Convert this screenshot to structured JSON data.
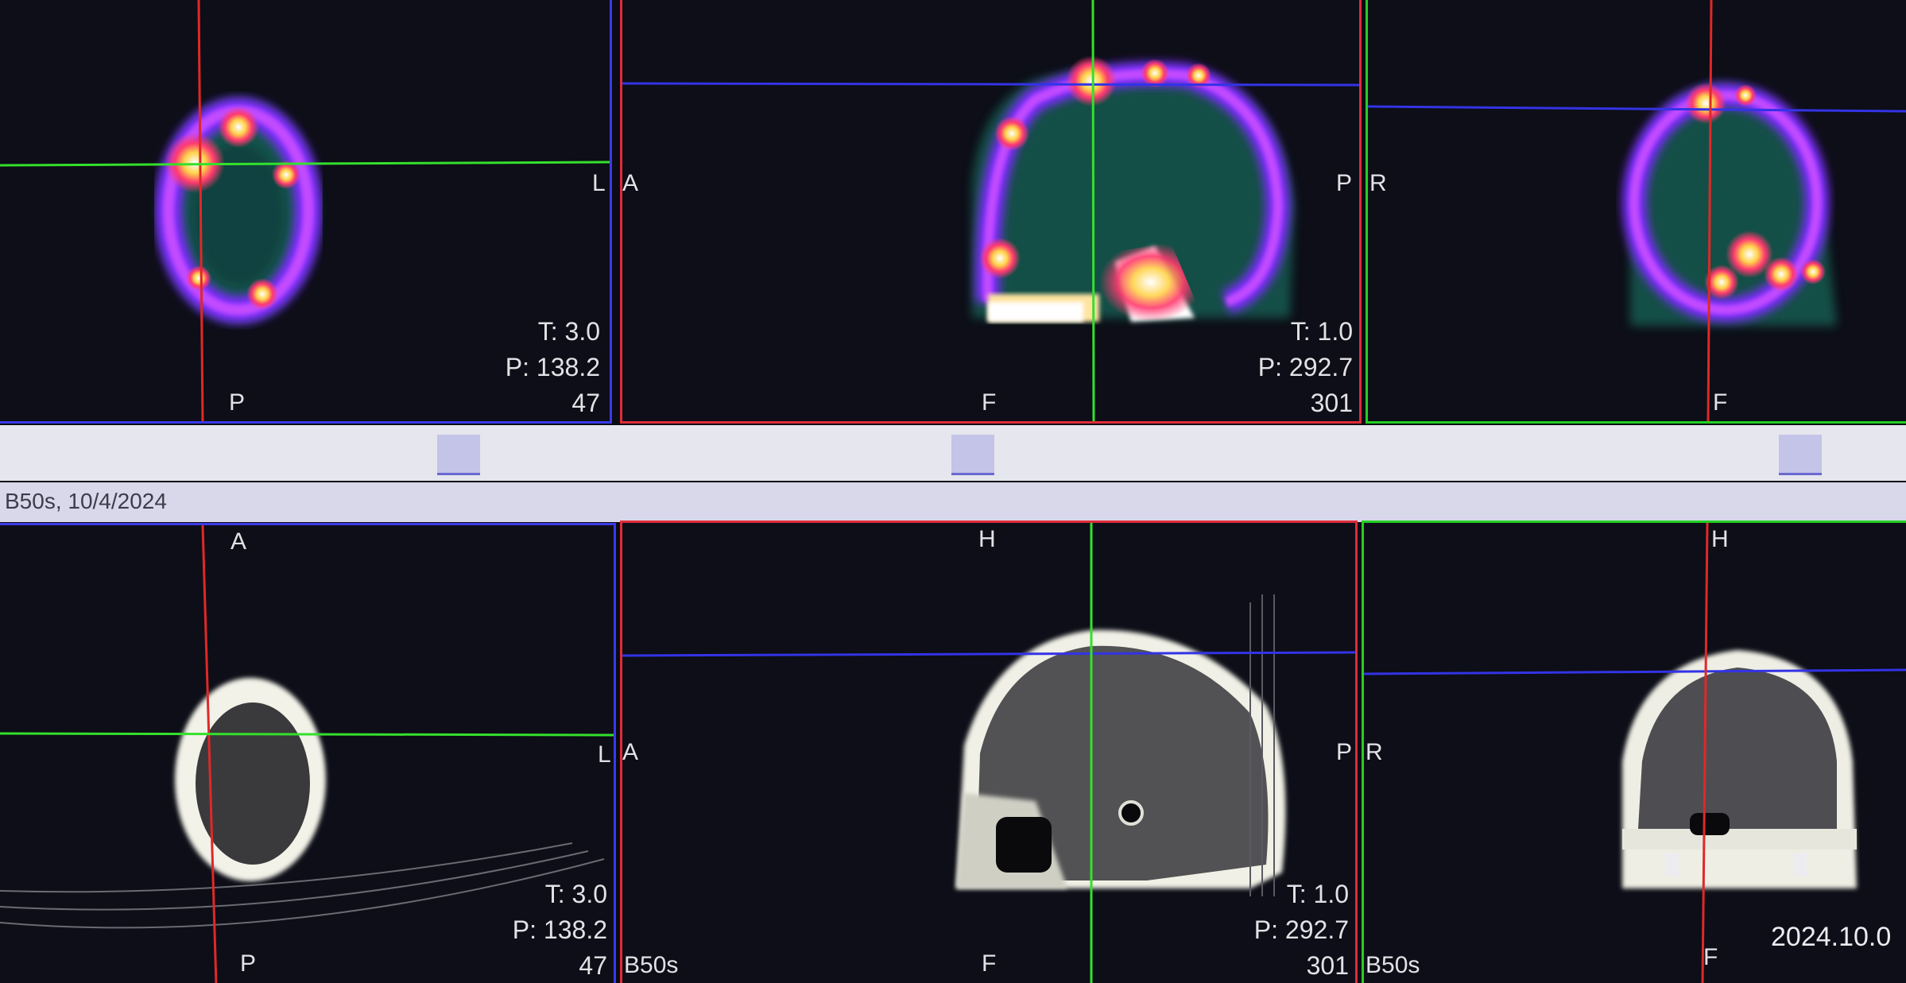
{
  "top_row": {
    "axial": {
      "right_label": "L",
      "bottom_label": "P",
      "thickness": "T: 3.0",
      "position": "P: 138.2",
      "slice": "47"
    },
    "sagittal": {
      "left_label": "A",
      "right_label": "P",
      "bottom_label": "F",
      "thickness": "T: 1.0",
      "position": "P: 292.7",
      "slice": "301"
    },
    "coronal": {
      "left_label": "R",
      "bottom_label": "F"
    }
  },
  "info_bar": {
    "text": "B50s, 10/4/2024"
  },
  "bottom_row": {
    "axial": {
      "top_label": "A",
      "right_label": "L",
      "bottom_label": "P",
      "thickness": "T: 3.0",
      "position": "P: 138.2",
      "slice": "47"
    },
    "sagittal": {
      "series": "B50s",
      "top_label": "H",
      "left_label": "A",
      "right_label": "P",
      "bottom_label": "F",
      "thickness": "T: 1.0",
      "position": "P: 292.7",
      "slice": "301"
    },
    "coronal": {
      "series": "B50s",
      "top_label": "H",
      "left_label": "R",
      "bottom_label": "F"
    }
  },
  "camera_timestamp": "2024.10.0",
  "colors": {
    "axial_border": "#3a3ae8",
    "sagittal_border": "#e02b3a",
    "coronal_border": "#22d022",
    "crosshair_red": "#e02828",
    "crosshair_green": "#34e02c",
    "crosshair_blue": "#3333e6"
  }
}
